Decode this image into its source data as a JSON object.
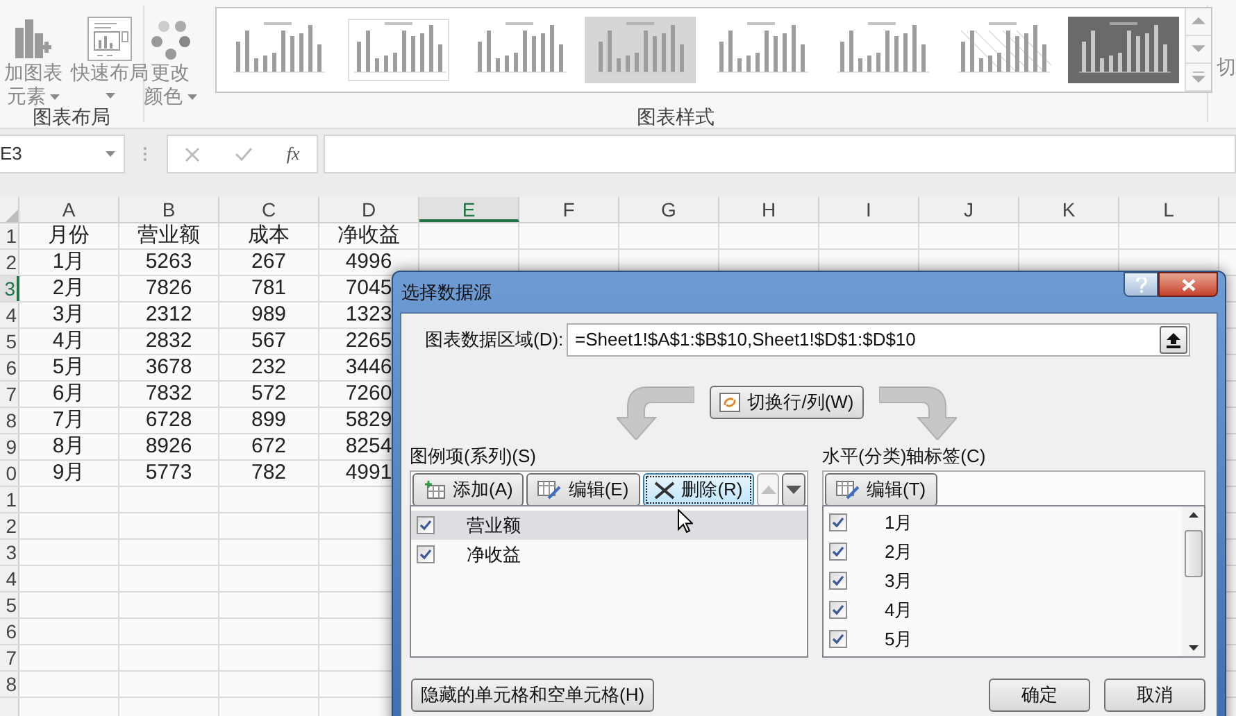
{
  "ribbon": {
    "groups": [
      {
        "label": "图表布局",
        "buttons": [
          {
            "kind": "add-element",
            "lines": [
              "加图表",
              "元素"
            ],
            "dropdown": true
          },
          {
            "kind": "quick-layout",
            "lines": [
              "快速布局"
            ],
            "dropdown": true
          }
        ]
      },
      {
        "label": "图表样式",
        "buttons": [
          {
            "kind": "colors",
            "lines": [
              "更改",
              "颜色"
            ],
            "dropdown": true
          }
        ],
        "styles": [
          {
            "kind": "plain"
          },
          {
            "kind": "outlined"
          },
          {
            "kind": "dotted"
          },
          {
            "kind": "shaded"
          },
          {
            "kind": "plain"
          },
          {
            "kind": "plain"
          },
          {
            "kind": "hatched"
          },
          {
            "kind": "dark"
          }
        ]
      }
    ],
    "cut_off_group": "切"
  },
  "formula_bar": {
    "name_box": "E3",
    "function_button": "fx"
  },
  "sheet": {
    "columns": [
      {
        "label": "A",
        "selected": false
      },
      {
        "label": "B",
        "selected": false
      },
      {
        "label": "C",
        "selected": false
      },
      {
        "label": "D",
        "selected": false
      },
      {
        "label": "E",
        "selected": true
      },
      {
        "label": "F",
        "selected": false
      },
      {
        "label": "G",
        "selected": false
      },
      {
        "label": "H",
        "selected": false
      },
      {
        "label": "I",
        "selected": false
      },
      {
        "label": "J",
        "selected": false
      },
      {
        "label": "K",
        "selected": false
      },
      {
        "label": "L",
        "selected": false
      }
    ],
    "rows": [
      {
        "header": "1",
        "selected": false,
        "cells": [
          "月份",
          "营业额",
          "成本",
          "净收益"
        ]
      },
      {
        "header": "2",
        "selected": false,
        "cells": [
          "1月",
          "5263",
          "267",
          "4996"
        ]
      },
      {
        "header": "3",
        "selected": true,
        "cells": [
          "2月",
          "7826",
          "781",
          "7045"
        ]
      },
      {
        "header": "4",
        "selected": false,
        "cells": [
          "3月",
          "2312",
          "989",
          "1323"
        ]
      },
      {
        "header": "5",
        "selected": false,
        "cells": [
          "4月",
          "2832",
          "567",
          "2265"
        ]
      },
      {
        "header": "6",
        "selected": false,
        "cells": [
          "5月",
          "3678",
          "232",
          "3446"
        ]
      },
      {
        "header": "7",
        "selected": false,
        "cells": [
          "6月",
          "7832",
          "572",
          "7260"
        ]
      },
      {
        "header": "8",
        "selected": false,
        "cells": [
          "7月",
          "6728",
          "899",
          "5829"
        ]
      },
      {
        "header": "9",
        "selected": false,
        "cells": [
          "8月",
          "8926",
          "672",
          "8254"
        ]
      },
      {
        "header": "0",
        "selected": false,
        "cells": [
          "9月",
          "5773",
          "782",
          "4991"
        ]
      },
      {
        "header": "1",
        "selected": false
      },
      {
        "header": "2",
        "selected": false
      },
      {
        "header": "3",
        "selected": false
      },
      {
        "header": "4",
        "selected": false
      },
      {
        "header": "5",
        "selected": false
      },
      {
        "header": "6",
        "selected": false
      },
      {
        "header": "7",
        "selected": false
      },
      {
        "header": "8",
        "selected": false
      },
      {
        "selected": false
      }
    ]
  },
  "dialog": {
    "title": "选择数据源",
    "data_range": {
      "label": "图表数据区域(D):",
      "value": "=Sheet1!$A$1:$B$10,Sheet1!$D$1:$D$10"
    },
    "switch_button": "切换行/列(W)",
    "series": {
      "label": "图例项(系列)(S)",
      "buttons": [
        {
          "kind": "add",
          "label": "添加(A)",
          "focused": false,
          "disabled": false
        },
        {
          "kind": "edit",
          "label": "编辑(E)",
          "focused": false,
          "disabled": false
        },
        {
          "kind": "delete",
          "label": "删除(R)",
          "focused": true,
          "disabled": false
        },
        {
          "kind": "up",
          "focused": false,
          "disabled": true
        },
        {
          "kind": "down",
          "focused": false,
          "disabled": false
        }
      ],
      "items": [
        {
          "label": "营业额",
          "checked": true,
          "selected": true
        },
        {
          "label": "净收益",
          "checked": true,
          "selected": false
        }
      ]
    },
    "categories": {
      "label": "水平(分类)轴标签(C)",
      "edit_button": "编辑(T)",
      "items": [
        {
          "label": "1月",
          "checked": true
        },
        {
          "label": "2月",
          "checked": true
        },
        {
          "label": "3月",
          "checked": true
        },
        {
          "label": "4月",
          "checked": true
        },
        {
          "label": "5月",
          "checked": true
        }
      ]
    },
    "hidden_cells_button": "隐藏的单元格和空单元格(H)",
    "ok_button": "确定",
    "cancel_button": "取消"
  }
}
